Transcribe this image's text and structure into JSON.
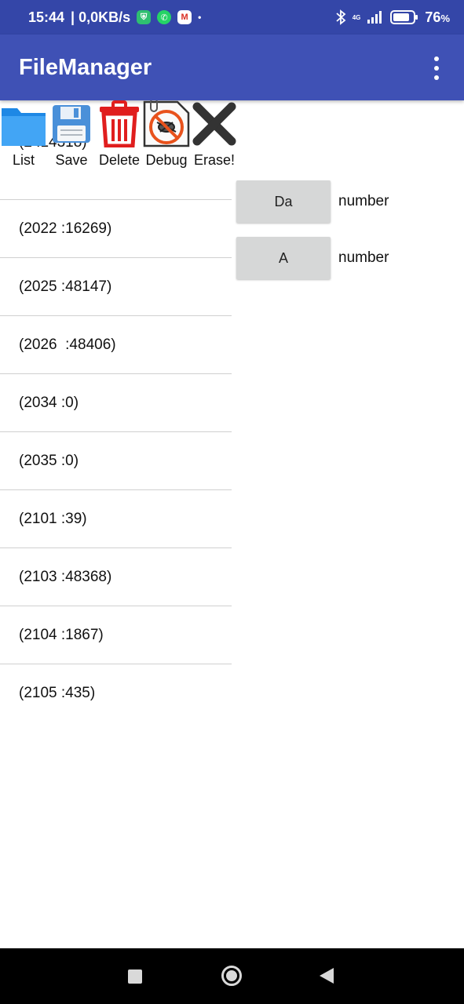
{
  "status": {
    "time": "15:44",
    "speed": "| 0,0KB/s",
    "battery": "76",
    "battery_unit": "%",
    "network": "4G"
  },
  "app": {
    "title": "FileManager"
  },
  "toolbar": {
    "list_label": "List",
    "save_label": "Save",
    "delete_label": "Delete",
    "debug_label": "Debug",
    "erase_label": "Erase!"
  },
  "list": {
    "items": [
      "(2 :14318)",
      "(2022 :16269)",
      "(2025 :48147)",
      "(2026  :48406)",
      "(2034 :0)",
      "(2035 :0)",
      "(2101 :39)",
      "(2103 :48368)",
      "(2104 :1867)",
      "(2105 :435)"
    ]
  },
  "panel": {
    "da_button": "Da",
    "da_label": "number",
    "a_button": "A",
    "a_label": "number"
  },
  "colors": {
    "status_bar": "#3446a8",
    "app_bar": "#3f51b5",
    "button": "#d6d7d7"
  }
}
